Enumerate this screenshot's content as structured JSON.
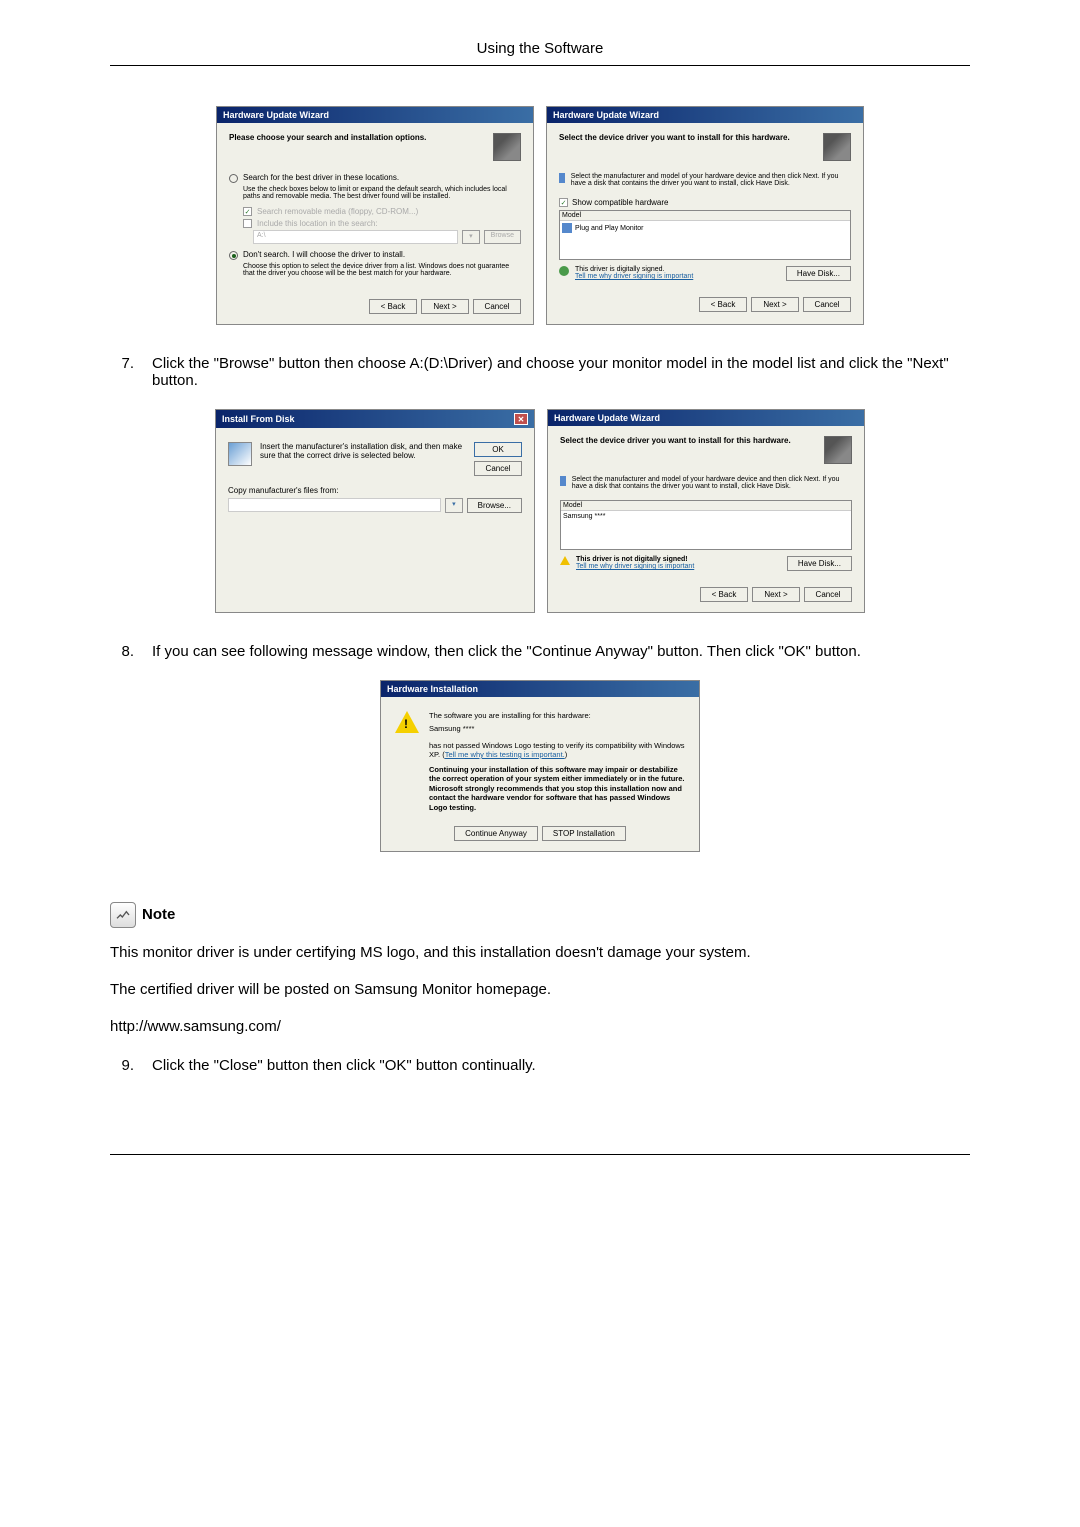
{
  "page_title": "Using the Software",
  "wizard_title": "Hardware Update Wizard",
  "wiz1": {
    "heading": "Please choose your search and installation options.",
    "radio1": "Search for the best driver in these locations.",
    "radio1_desc": "Use the check boxes below to limit or expand the default search, which includes local paths and removable media. The best driver found will be installed.",
    "chk1": "Search removable media (floppy, CD-ROM...)",
    "chk2": "Include this location in the search:",
    "path_value": "A:\\",
    "browse_btn": "Browse",
    "radio2": "Don't search. I will choose the driver to install.",
    "radio2_desc": "Choose this option to select the device driver from a list. Windows does not guarantee that the driver you choose will be the best match for your hardware.",
    "back": "< Back",
    "next": "Next >",
    "cancel": "Cancel"
  },
  "wiz2": {
    "heading": "Select the device driver you want to install for this hardware.",
    "desc": "Select the manufacturer and model of your hardware device and then click Next. If you have a disk that contains the driver you want to install, click Have Disk.",
    "show_compat": "Show compatible hardware",
    "model_header": "Model",
    "model_item": "Plug and Play Monitor",
    "signed": "This driver is digitally signed.",
    "tellme": "Tell me why driver signing is important",
    "have_disk": "Have Disk..."
  },
  "step7": "Click the \"Browse\" button then choose A:(D:\\Driver) and choose your monitor model in the model list and click the \"Next\" button.",
  "install_disk": {
    "title": "Install From Disk",
    "text": "Insert the manufacturer's installation disk, and then make sure that the correct drive is selected below.",
    "ok": "OK",
    "cancel": "Cancel",
    "copy_label": "Copy manufacturer's files from:",
    "browse": "Browse..."
  },
  "wiz3": {
    "model_item": "Samsung ****",
    "not_signed": "This driver is not digitally signed!"
  },
  "step8": "If you can see following message window, then click the \"Continue Anyway\" button. Then click \"OK\" button.",
  "hwinstall": {
    "title": "Hardware Installation",
    "line1": "The software you are installing for this hardware:",
    "device": "Samsung ****",
    "line2_a": "has not passed Windows Logo testing to verify its compatibility with Windows XP. (",
    "line2_link": "Tell me why this testing is important.",
    "line2_b": ")",
    "bold": "Continuing your installation of this software may impair or destabilize the correct operation of your system either immediately or in the future. Microsoft strongly recommends that you stop this installation now and contact the hardware vendor for software that has passed Windows Logo testing.",
    "continue": "Continue Anyway",
    "stop": "STOP Installation"
  },
  "note_label": "Note",
  "note_p1": "This monitor driver is under certifying MS logo, and this installation doesn't damage your system.",
  "note_p2": "The certified driver will be posted on Samsung Monitor homepage.",
  "note_url": "http://www.samsung.com/",
  "step9": "Click the \"Close\" button then click \"OK\" button continually."
}
